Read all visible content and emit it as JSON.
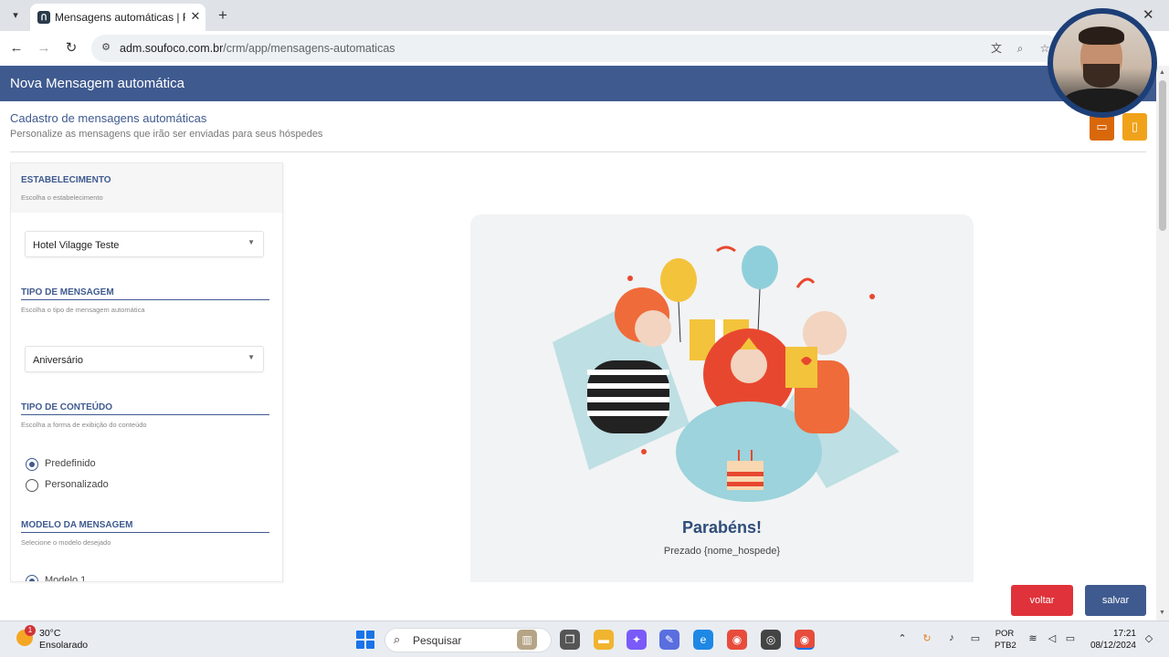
{
  "browser": {
    "tab_title": "Mensagens automáticas | Relac",
    "url_domain": "adm.soufoco.com.br",
    "url_path": "/crm/app/mensagens-automaticas"
  },
  "header": {
    "title": "Nova Mensagem automática"
  },
  "page": {
    "section_title": "Cadastro de mensagens automáticas",
    "section_subtitle": "Personalize as mensagens que irão ser enviadas para seus hóspedes"
  },
  "form": {
    "estabelecimento": {
      "label": "ESTABELECIMENTO",
      "hint": "Escolha o estabelecimento",
      "value": "Hotel Vilagge Teste"
    },
    "tipo_mensagem": {
      "label": "TIPO DE MENSAGEM",
      "hint": "Escolha o tipo de mensagem automática",
      "value": "Aniversário"
    },
    "tipo_conteudo": {
      "label": "TIPO DE CONTEÚDO",
      "hint": "Escolha a forma de exibição do conteúdo",
      "options": [
        "Predefinido",
        "Personalizado"
      ],
      "selected": "Predefinido"
    },
    "modelo": {
      "label": "MODELO DA MENSAGEM",
      "hint": "Selecione o modelo desejado",
      "first_option": "Modelo 1"
    }
  },
  "preview": {
    "title": "Parabéns!",
    "subtitle": "Prezado {nome_hospede}"
  },
  "buttons": {
    "back": "voltar",
    "save": "salvar"
  },
  "colors": {
    "header_bg": "#3f5a8f",
    "desktop_btn": "#d9680b",
    "mobile_btn": "#f0a21b",
    "back_btn": "#e0323a",
    "save_btn": "#3f5a8f"
  },
  "taskbar": {
    "weather_temp": "30°C",
    "weather_desc": "Ensolarado",
    "weather_badge": "1",
    "search_label": "Pesquisar",
    "lang_1": "POR",
    "lang_2": "PTB2",
    "time": "17:21",
    "date": "08/12/2024"
  }
}
